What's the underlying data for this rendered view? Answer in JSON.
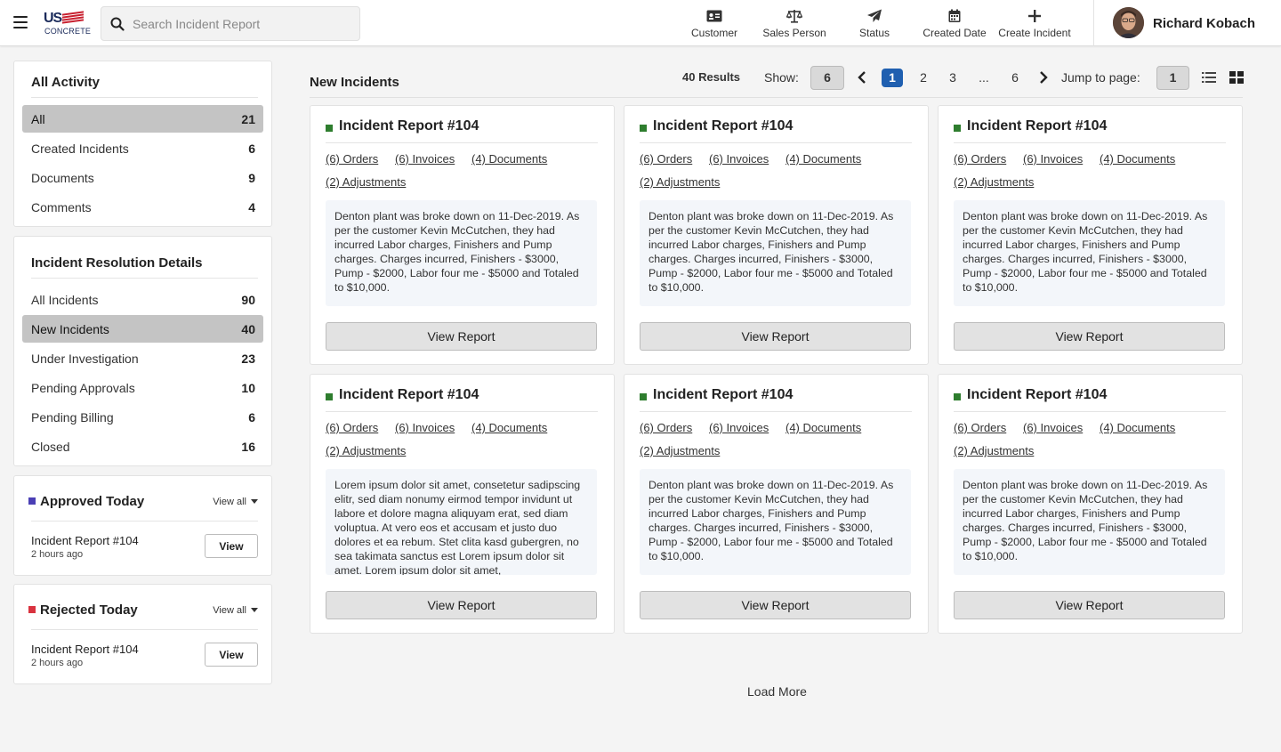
{
  "header": {
    "logo_us": "US",
    "logo_sub": "CONCRETE",
    "search_placeholder": "Search Incident Report",
    "tools": [
      {
        "label": "Customer",
        "icon": "id-card-icon"
      },
      {
        "label": "Sales Person",
        "icon": "scales-icon"
      },
      {
        "label": "Status",
        "icon": "paper-plane-icon"
      },
      {
        "label": "Created Date",
        "icon": "calendar-icon"
      },
      {
        "label": "Create Incident",
        "icon": "plus-icon"
      }
    ],
    "user_name": "Richard Kobach"
  },
  "sidebar": {
    "activity": {
      "title": "All Activity",
      "items": [
        {
          "label": "All",
          "count": "21"
        },
        {
          "label": "Created Incidents",
          "count": "6"
        },
        {
          "label": "Documents",
          "count": "9"
        },
        {
          "label": "Comments",
          "count": "4"
        }
      ]
    },
    "resolution": {
      "title": "Incident Resolution Details",
      "items": [
        {
          "label": "All Incidents",
          "count": "90"
        },
        {
          "label": "New Incidents",
          "count": "40"
        },
        {
          "label": "Under Investigation",
          "count": "23"
        },
        {
          "label": "Pending Approvals",
          "count": "10"
        },
        {
          "label": "Pending Billing",
          "count": "6"
        },
        {
          "label": "Closed",
          "count": "16"
        }
      ]
    },
    "approved": {
      "title": "Approved Today",
      "view_all": "View all",
      "item_title": "Incident Report #104",
      "item_time": "2 hours ago",
      "button": "View",
      "color": "#4a3fb5"
    },
    "rejected": {
      "title": "Rejected Today",
      "view_all": "View all",
      "item_title": "Incident Report #104",
      "item_time": "2 hours ago",
      "button": "View",
      "color": "#d9333f"
    }
  },
  "main": {
    "title": "New Incidents",
    "results": "40 Results",
    "show_label": "Show:",
    "show_value": "6",
    "pages": [
      "1",
      "2",
      "3",
      "...",
      "6"
    ],
    "jump_label": "Jump to page:",
    "jump_value": "1",
    "load_more": "Load More",
    "status_color": "#2e7d2e",
    "cards": [
      {
        "title": "Incident Report #104",
        "orders": "(6) Orders",
        "invoices": "(6) Invoices",
        "documents": "(4) Documents",
        "adjustments": "(2) Adjustments",
        "desc": "Denton plant was broke down on 11-Dec-2019. As per the customer Kevin McCutchen, they had incurred Labor charges, Finishers and Pump charges. Charges incurred, Finishers - $3000, Pump - $2000, Labor four me - $5000 and Totaled to $10,000.",
        "button": "View Report"
      },
      {
        "title": "Incident Report #104",
        "orders": "(6) Orders",
        "invoices": "(6) Invoices",
        "documents": "(4) Documents",
        "adjustments": "(2) Adjustments",
        "desc": "Denton plant was broke down on 11-Dec-2019. As per the customer Kevin McCutchen, they had incurred Labor charges, Finishers and Pump charges. Charges incurred, Finishers - $3000, Pump - $2000, Labor four me - $5000 and Totaled to $10,000.",
        "button": "View Report"
      },
      {
        "title": "Incident Report #104",
        "orders": "(6) Orders",
        "invoices": "(6) Invoices",
        "documents": "(4) Documents",
        "adjustments": "(2) Adjustments",
        "desc": "Denton plant was broke down on 11-Dec-2019. As per the customer Kevin McCutchen, they had incurred Labor charges, Finishers and Pump charges. Charges incurred, Finishers - $3000, Pump - $2000, Labor four me - $5000 and Totaled to $10,000.",
        "button": "View Report"
      },
      {
        "title": "Incident Report #104",
        "orders": "(6) Orders",
        "invoices": "(6) Invoices",
        "documents": "(4) Documents",
        "adjustments": "(2) Adjustments",
        "desc": "Lorem ipsum dolor sit amet, consetetur sadipscing elitr, sed diam nonumy eirmod tempor invidunt ut labore et dolore magna aliquyam erat, sed diam voluptua. At vero eos et accusam et justo duo dolores et ea rebum. Stet clita kasd gubergren, no sea takimata sanctus est Lorem ipsum dolor sit amet. Lorem ipsum dolor sit amet,",
        "button": "View Report"
      },
      {
        "title": "Incident Report #104",
        "orders": "(6) Orders",
        "invoices": "(6) Invoices",
        "documents": "(4) Documents",
        "adjustments": "(2) Adjustments",
        "desc": "Denton plant was broke down on 11-Dec-2019. As per the customer Kevin McCutchen, they had incurred Labor charges, Finishers and Pump charges. Charges incurred, Finishers - $3000, Pump - $2000, Labor four me - $5000 and Totaled to $10,000.",
        "button": "View Report"
      },
      {
        "title": "Incident Report #104",
        "orders": "(6) Orders",
        "invoices": "(6) Invoices",
        "documents": "(4) Documents",
        "adjustments": "(2) Adjustments",
        "desc": "Denton plant was broke down on 11-Dec-2019. As per the customer Kevin McCutchen, they had incurred Labor charges, Finishers and Pump charges. Charges incurred, Finishers - $3000, Pump - $2000, Labor four me - $5000 and Totaled to $10,000.",
        "button": "View Report"
      }
    ]
  }
}
